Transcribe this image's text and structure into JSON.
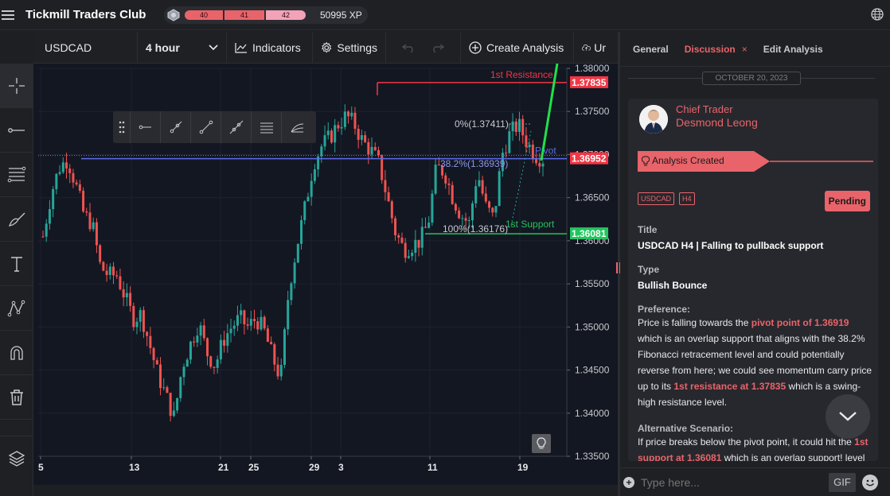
{
  "app": {
    "title": "Tickmill Traders Club",
    "xp_levels": [
      "40",
      "41",
      "42"
    ],
    "xp_value": "50995 XP"
  },
  "toolbar": {
    "symbol": "USDCAD",
    "interval": "4 hour",
    "indicators_label": "Indicators",
    "settings_label": "Settings",
    "create_label": "Create Analysis",
    "upload_label": "Ur"
  },
  "chart_data": {
    "type": "candlestick",
    "symbol": "USDCAD",
    "timeframe": "4 hour",
    "x_tick_labels": [
      "5",
      "13",
      "21",
      "25",
      "29",
      "3",
      "11",
      "19"
    ],
    "y_tick_labels": [
      "1.38000",
      "1.37500",
      "1.37000",
      "1.36500",
      "1.36000",
      "1.35500",
      "1.35000",
      "1.34500",
      "1.34000",
      "1.33500"
    ],
    "ylim": [
      1.335,
      1.38
    ],
    "close_path": [
      1.3605,
      1.3655,
      1.3685,
      1.3695,
      1.3665,
      1.363,
      1.362,
      1.357,
      1.356,
      1.356,
      1.3535,
      1.351,
      1.3515,
      1.348,
      1.3445,
      1.342,
      1.3395,
      1.3455,
      1.348,
      1.3505,
      1.347,
      1.3455,
      1.3485,
      1.35,
      1.351,
      1.35,
      1.351,
      1.3495,
      1.3465,
      1.344,
      1.3545,
      1.3595,
      1.364,
      1.369,
      1.371,
      1.372,
      1.3735,
      1.3745,
      1.3735,
      1.3715,
      1.3705,
      1.369,
      1.365,
      1.361,
      1.359,
      1.3595,
      1.36,
      1.362,
      1.3685,
      1.368,
      1.365,
      1.363,
      1.362,
      1.368,
      1.364,
      1.3625,
      1.37,
      1.3725,
      1.3735,
      1.3715,
      1.37,
      1.3695
    ],
    "annotations": [
      {
        "label": "1st Resistance",
        "price": "1.37835",
        "color": "#f23645"
      },
      {
        "label": "Pivot",
        "price": "1.36952",
        "color": "#5b6ce8"
      },
      {
        "label": "1st Support",
        "price": "1.36081",
        "color": "#22c55e"
      }
    ],
    "fib_levels": [
      {
        "label": "0%(1.37411)"
      },
      {
        "label": "38.2%(1.36939)"
      },
      {
        "label": "100%(1.36176)"
      }
    ],
    "price_badges": [
      {
        "value": "1.37835",
        "color": "#f23645"
      },
      {
        "value": "1.36952",
        "color": "#f23645"
      },
      {
        "value": "1.36081",
        "color": "#22c55e"
      }
    ]
  },
  "panel": {
    "tabs": [
      {
        "label": "General"
      },
      {
        "label": "Discussion",
        "active": true,
        "close": "×"
      },
      {
        "label": "Edit Analysis"
      }
    ],
    "date": "OCTOBER 20, 2023",
    "author_role": "Chief Trader",
    "author_name": "Desmond Leong",
    "banner": "Analysis Created",
    "tags": [
      "USDCAD",
      "H4"
    ],
    "status": "Pending",
    "title_label": "Title",
    "title_value": "USDCAD H4 | Falling to pullback support",
    "type_label": "Type",
    "type_value": "Bullish Bounce",
    "preference_label": "Preference:",
    "pref_1": "Price is falling towards the ",
    "pref_hl1": "pivot point of 1.36919",
    "pref_2": " which is an overlap support that aligns with the 38.2% Fibonacci retracement level and could potentially reverse from here; we could see momentum carry price up to its ",
    "pref_hl2": "1st resistance at 1.37835",
    "pref_3": " which is a swing-high resistance level.",
    "alt_label": "Alternative Scenario:",
    "alt_1": "If price breaks below the pivot point, it could hit the ",
    "alt_hl": "1st support at 1.36081",
    "alt_2": " which is an overlap support! level",
    "composer_placeholder": "Type here...",
    "gif_label": "GIF"
  }
}
